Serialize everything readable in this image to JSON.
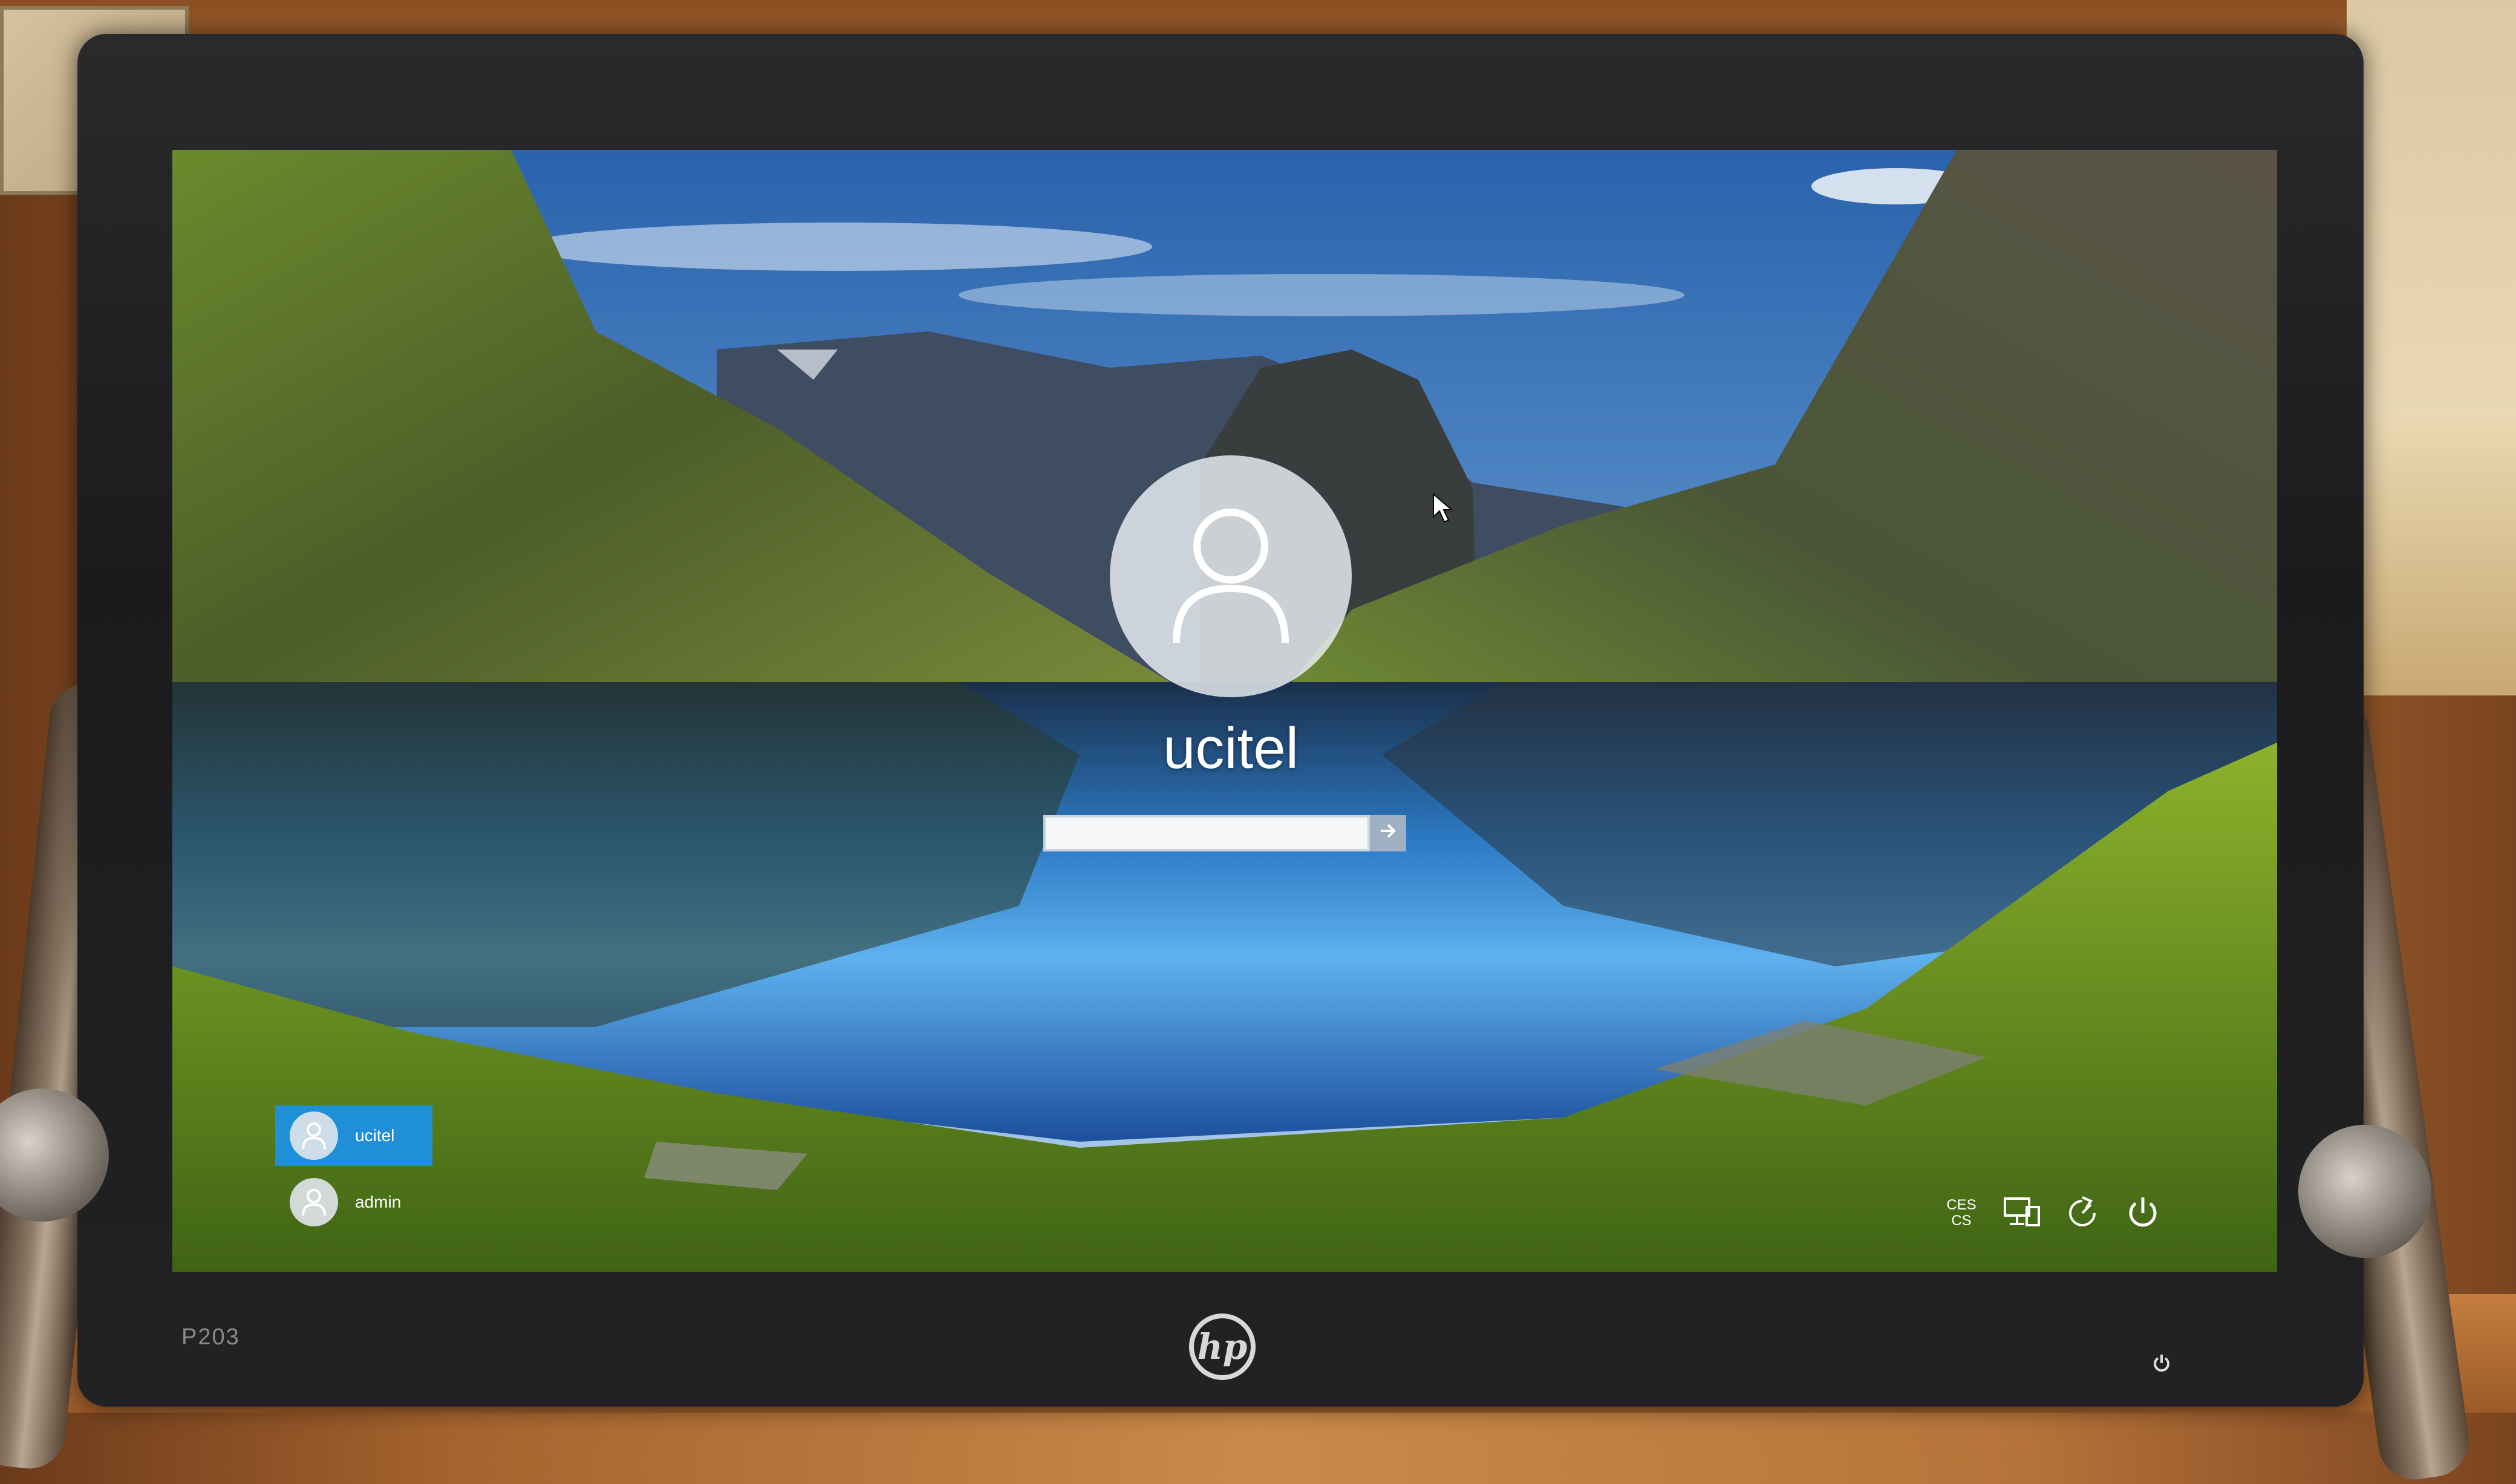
{
  "monitor": {
    "model": "P203",
    "brand": "hp"
  },
  "lockscreen": {
    "username": "ucitel",
    "password": {
      "value": "",
      "placeholder": ""
    },
    "submit_icon": "arrow-right-icon"
  },
  "users": [
    {
      "name": "ucitel",
      "selected": true
    },
    {
      "name": "admin",
      "selected": false
    }
  ],
  "tray": {
    "language": {
      "line1": "CES",
      "line2": "CS"
    },
    "icons": [
      "network-icon",
      "ease-of-access-icon",
      "power-icon"
    ]
  },
  "colors": {
    "selected_user": "#1e90d8",
    "accent_text": "#ffffff"
  }
}
